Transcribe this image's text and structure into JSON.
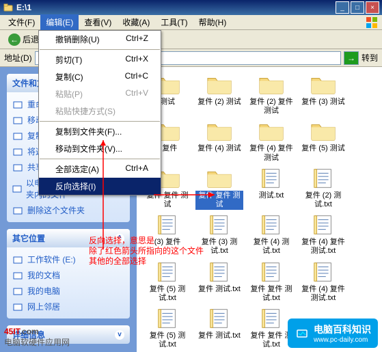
{
  "window": {
    "title": "E:\\1"
  },
  "menubar": {
    "file": "文件(F)",
    "edit": "编辑(E)",
    "view": "查看(V)",
    "favorites": "收藏(A)",
    "tools": "工具(T)",
    "help": "帮助(H)"
  },
  "toolbar": {
    "back": "后退"
  },
  "addressbar": {
    "label": "地址(D)",
    "value": "E:\\1",
    "go": "转到"
  },
  "dropdown": {
    "items": [
      {
        "label": "撤销删除(U)",
        "shortcut": "Ctrl+Z",
        "disabled": false
      },
      {
        "sep": true
      },
      {
        "label": "剪切(T)",
        "shortcut": "Ctrl+X",
        "disabled": false
      },
      {
        "label": "复制(C)",
        "shortcut": "Ctrl+C",
        "disabled": false
      },
      {
        "label": "粘贴(P)",
        "shortcut": "Ctrl+V",
        "disabled": true
      },
      {
        "label": "粘贴快捷方式(S)",
        "shortcut": "",
        "disabled": true
      },
      {
        "sep": true
      },
      {
        "label": "复制到文件夹(F)...",
        "shortcut": "",
        "disabled": false
      },
      {
        "label": "移动到文件夹(V)...",
        "shortcut": "",
        "disabled": false
      },
      {
        "sep": true
      },
      {
        "label": "全部选定(A)",
        "shortcut": "Ctrl+A",
        "disabled": false
      },
      {
        "label": "反向选择(I)",
        "shortcut": "",
        "highlighted": true
      }
    ]
  },
  "sidebar": {
    "panels": {
      "tasks": {
        "title": "文件和文件夹任务",
        "items": [
          {
            "label": "重命名这个文件夹",
            "icon": "rename-icon"
          },
          {
            "label": "移动这个文件夹",
            "icon": "move-icon"
          },
          {
            "label": "复制这个文件夹",
            "icon": "copy-icon"
          },
          {
            "label": "将这个文件夹发布到 Web",
            "icon": "web-icon"
          },
          {
            "label": "共享此文件夹",
            "icon": "share-icon"
          },
          {
            "label": "以电子邮件形式发送该文件夹内的文件",
            "icon": "email-icon"
          },
          {
            "label": "删除这个文件夹",
            "icon": "delete-icon"
          }
        ]
      },
      "other": {
        "title": "其它位置",
        "items": [
          {
            "label": "工作软件 (E:)",
            "icon": "drive-icon"
          },
          {
            "label": "我的文档",
            "icon": "documents-icon"
          },
          {
            "label": "我的电脑",
            "icon": "computer-icon"
          },
          {
            "label": "网上邻居",
            "icon": "network-icon"
          }
        ]
      },
      "details": {
        "title": "详细信息"
      }
    }
  },
  "files": [
    {
      "type": "folder",
      "label": "测试"
    },
    {
      "type": "folder",
      "label": "复件 (2) 测试"
    },
    {
      "type": "folder",
      "label": "复件 (2) 复件 测试"
    },
    {
      "type": "folder",
      "label": "复件 (3) 测试"
    },
    {
      "type": "folder",
      "label": ") 复件"
    },
    {
      "type": "folder",
      "label": "复件 (4) 测试"
    },
    {
      "type": "folder",
      "label": "复件 (4) 复件 测试"
    },
    {
      "type": "folder",
      "label": "复件 (5) 测试"
    },
    {
      "type": "folder",
      "label": "复件 复件 测试"
    },
    {
      "type": "folder",
      "label": "复件 复件 测试",
      "selected": true
    },
    {
      "type": "txt",
      "label": "测试.txt"
    },
    {
      "type": "txt",
      "label": "复件 (2) 测试.txt"
    },
    {
      "type": "txt",
      "label": "(3) 复件"
    },
    {
      "type": "txt",
      "label": "复件 (3) 测试.txt"
    },
    {
      "type": "txt",
      "label": "复件 (4) 测试.txt"
    },
    {
      "type": "txt",
      "label": "复件 (4) 复件 测试.txt"
    },
    {
      "type": "txt",
      "label": "复件 (5) 测试.txt"
    },
    {
      "type": "txt",
      "label": "复件 测试.txt"
    },
    {
      "type": "txt",
      "label": "复件 复件 测试.txt"
    },
    {
      "type": "txt",
      "label": "复件 (4) 复件 测试.txt"
    },
    {
      "type": "txt",
      "label": "复件 (5) 测试.txt"
    },
    {
      "type": "txt",
      "label": "复件 测试.txt"
    },
    {
      "type": "txt",
      "label": "复件 复件 测试.txt"
    }
  ],
  "annotation": {
    "line1": "反向选择，意思是",
    "line2": "除了红色箭头所指向的这个文件",
    "line3": "其他的全部选择"
  },
  "footer": {
    "left_logo": "45IT",
    "left_domain": ".com",
    "left_sub": "电脑软硬件应用网",
    "right_cn": "电脑百科知识",
    "right_domain": "www.pc-daily.com"
  }
}
